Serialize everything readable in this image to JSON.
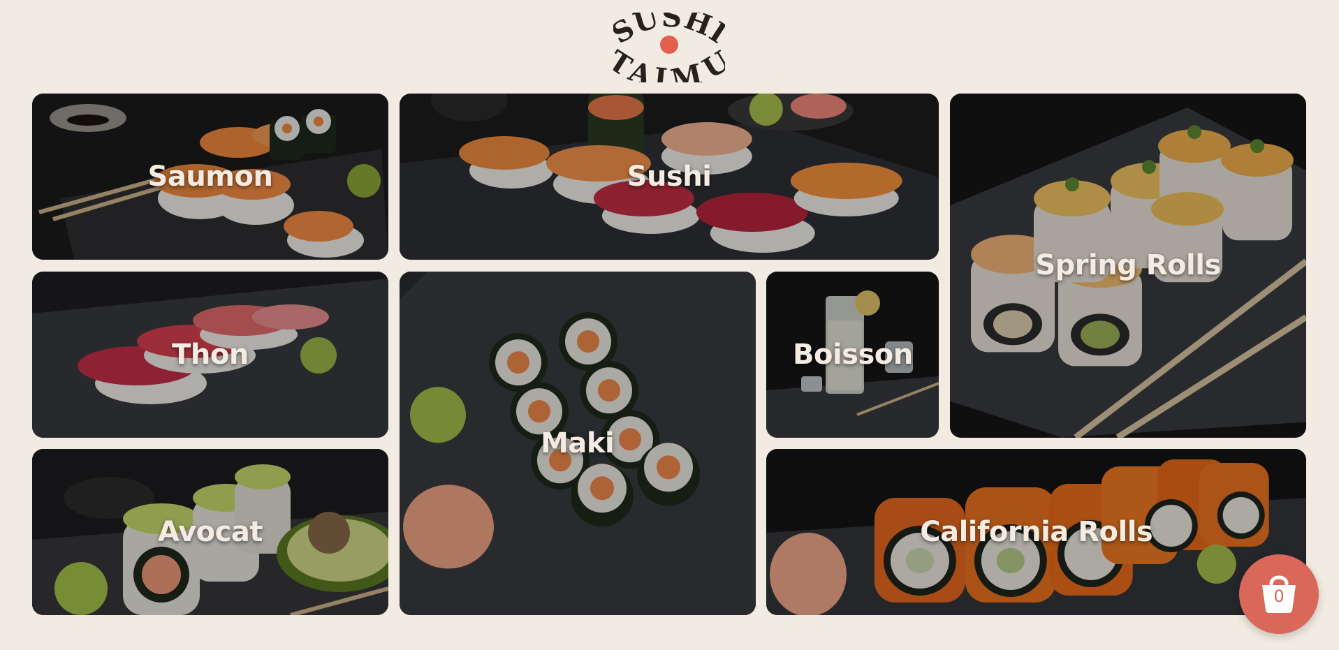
{
  "brand": {
    "line1": "SUSHI",
    "line2": "TAIMU",
    "text_color": "#2a1f1c",
    "dot_color": "#e2604d"
  },
  "colors": {
    "page_background": "#f1ebe2",
    "tile_label": "#f4ece2",
    "cart_button": "#d9685a"
  },
  "categories": [
    {
      "id": "saumon",
      "label": "Saumon"
    },
    {
      "id": "sushi",
      "label": "Sushi"
    },
    {
      "id": "spring",
      "label": "Spring Rolls"
    },
    {
      "id": "thon",
      "label": "Thon"
    },
    {
      "id": "maki",
      "label": "Maki"
    },
    {
      "id": "boisson",
      "label": "Boisson"
    },
    {
      "id": "avocat",
      "label": "Avocat"
    },
    {
      "id": "california",
      "label": "California Rolls"
    }
  ],
  "cart": {
    "icon": "shopping-bag-icon",
    "count": "0"
  }
}
